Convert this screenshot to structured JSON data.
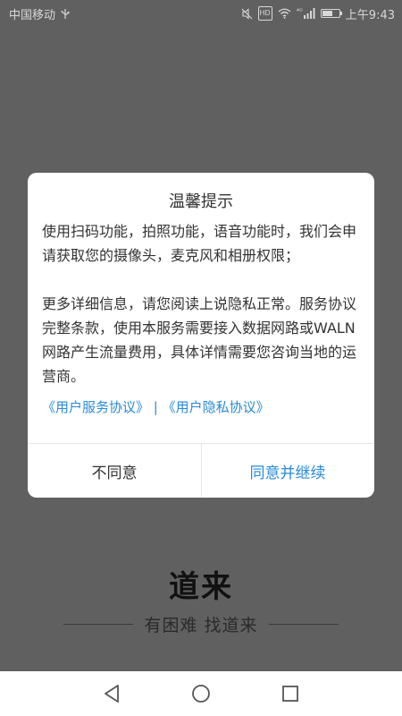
{
  "status_bar": {
    "carrier": "中国移动",
    "network_label": "⁴ᴳ",
    "hd_label": "HD",
    "time": "上午9:43",
    "battery_level": 0.6
  },
  "dialog": {
    "title": "温馨提示",
    "paragraph1": "使用扫码功能，拍照功能，语音功能时，我们会申请获取您的摄像头，麦克风和相册权限；",
    "paragraph2": "更多详细信息，请您阅读上说隐私正常。服务协议完整条款，使用本服务需要接入数据网路或WALN网路产生流量费用，具体详情需要您咨询当地的运营商。",
    "link_service": "《用户服务协议》",
    "link_separator": "|",
    "link_privacy": "《用户隐私协议》",
    "disagree_label": "不同意",
    "agree_label": "同意并继续"
  },
  "brand": {
    "name": "道来",
    "tagline": "有困难 找道来"
  },
  "colors": {
    "overlay": "#606060",
    "accent": "#2a8ad8"
  },
  "icons": {
    "back": "triangle-left",
    "home": "circle",
    "recents": "square"
  }
}
